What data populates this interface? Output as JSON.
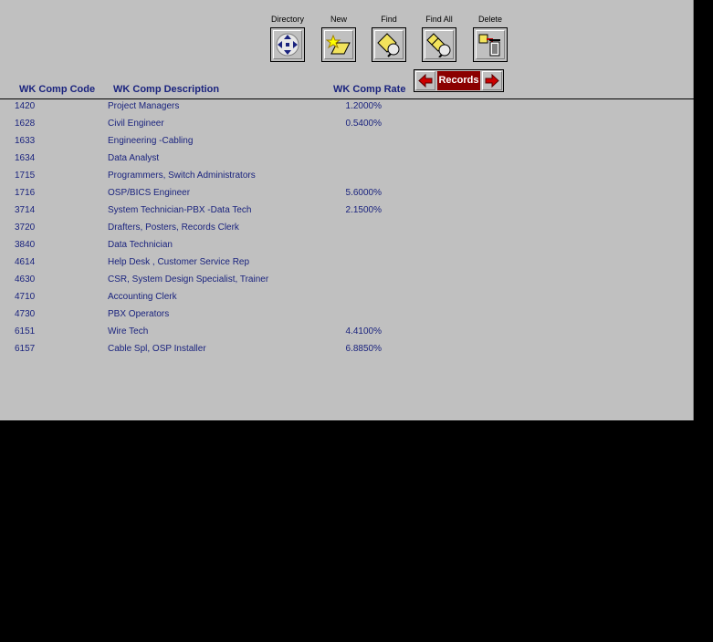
{
  "toolbar": {
    "directory_label": "Directory",
    "new_label": "New",
    "find_label": "Find",
    "find_all_label": "Find All",
    "delete_label": "Delete"
  },
  "records_nav": {
    "label": "Records"
  },
  "headers": {
    "code": "WK Comp Code",
    "description": "WK Comp Description",
    "rate": "WK Comp Rate"
  },
  "rows": [
    {
      "code": "1420",
      "description": "Project Managers",
      "rate": "1.2000%"
    },
    {
      "code": "1628",
      "description": "Civil Engineer",
      "rate": "0.5400%"
    },
    {
      "code": "1633",
      "description": "Engineering -Cabling",
      "rate": ""
    },
    {
      "code": "1634",
      "description": "Data Analyst",
      "rate": ""
    },
    {
      "code": "1715",
      "description": "Programmers, Switch Administrators",
      "rate": ""
    },
    {
      "code": "1716",
      "description": "OSP/BICS Engineer",
      "rate": "5.6000%"
    },
    {
      "code": "3714",
      "description": "System Technician-PBX -Data Tech",
      "rate": "2.1500%"
    },
    {
      "code": "3720",
      "description": "Drafters, Posters, Records Clerk",
      "rate": ""
    },
    {
      "code": "3840",
      "description": "Data Technician",
      "rate": ""
    },
    {
      "code": "4614",
      "description": "Help Desk , Customer Service Rep",
      "rate": ""
    },
    {
      "code": "4630",
      "description": "CSR, System Design Specialist, Trainer",
      "rate": ""
    },
    {
      "code": "4710",
      "description": "Accounting Clerk",
      "rate": ""
    },
    {
      "code": "4730",
      "description": "PBX Operators",
      "rate": ""
    },
    {
      "code": "6151",
      "description": "Wire Tech",
      "rate": "4.4100%"
    },
    {
      "code": "6157",
      "description": "Cable Spl, OSP Installer",
      "rate": "6.8850%"
    }
  ],
  "colors": {
    "panel_bg": "#c0c0c0",
    "text_navy": "#1a237e",
    "records_red": "#8b0000",
    "outside_bg": "#000000"
  }
}
